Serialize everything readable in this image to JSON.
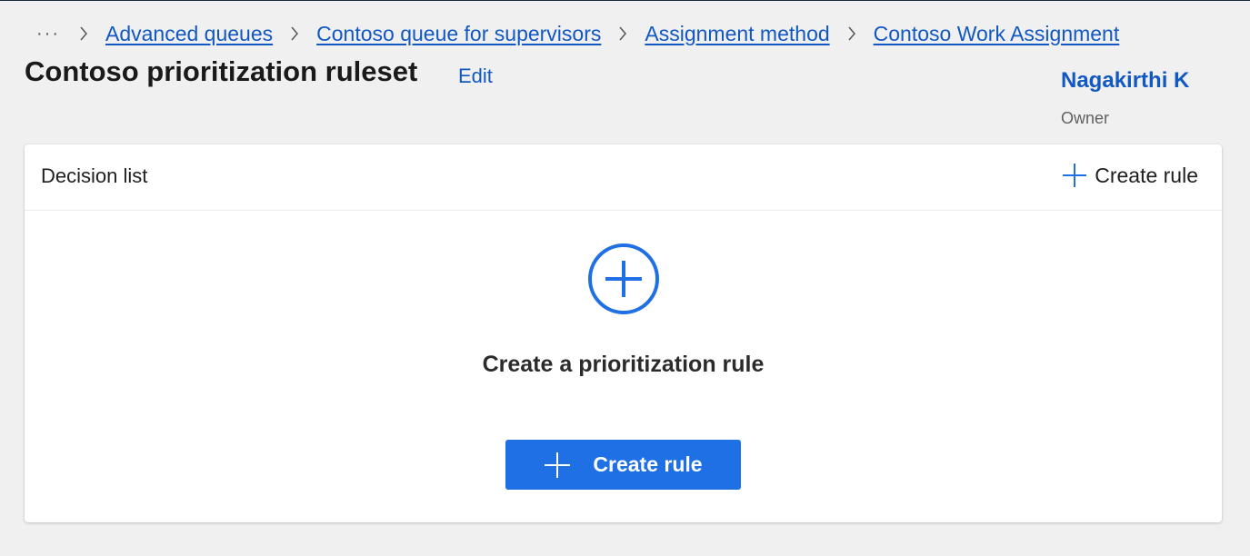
{
  "breadcrumb": {
    "more": "···",
    "items": [
      {
        "label": "Advanced queues"
      },
      {
        "label": "Contoso queue for supervisors"
      },
      {
        "label": "Assignment method"
      },
      {
        "label": "Contoso Work Assignment"
      }
    ]
  },
  "header": {
    "title": "Contoso prioritization ruleset",
    "edit_label": "Edit"
  },
  "owner": {
    "name": "Nagakirthi K",
    "role": "Owner"
  },
  "decision_list": {
    "title": "Decision list",
    "create_rule_label": "Create rule",
    "empty_state_text": "Create a prioritization rule",
    "primary_button_label": "Create rule"
  },
  "colors": {
    "accent": "#1f6fe5",
    "link": "#1258c3",
    "background": "#f0f0f0"
  },
  "icons": {
    "more": "more-horizontal-icon",
    "separator": "chevron-right-icon",
    "add": "plus-icon",
    "add_circle": "add-circle-icon"
  }
}
